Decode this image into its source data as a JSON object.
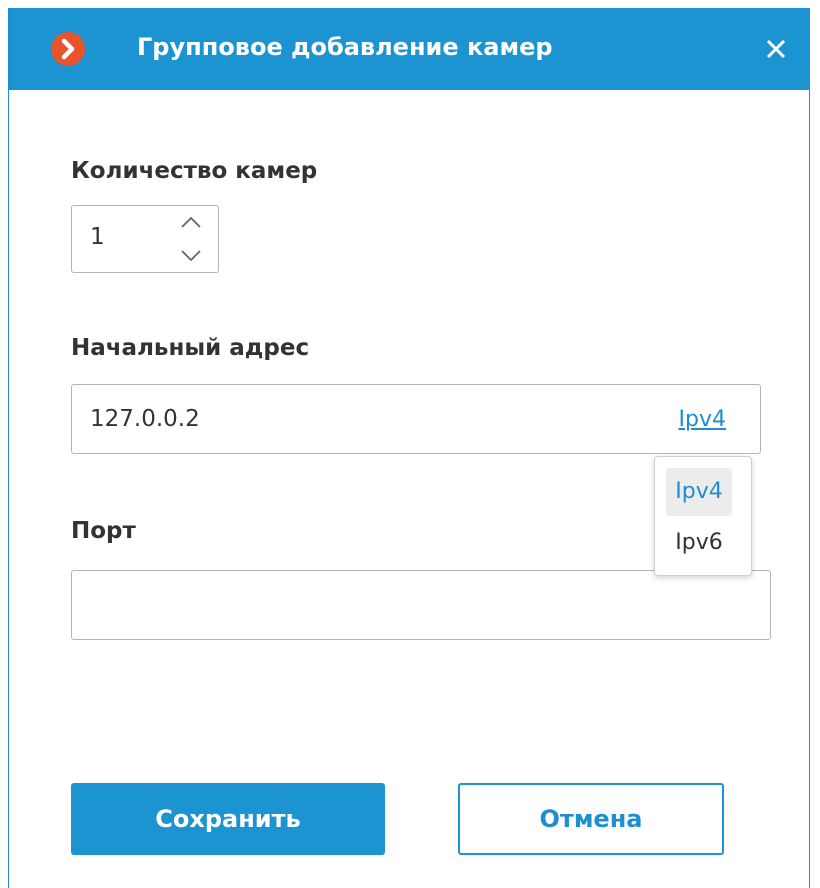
{
  "dialog": {
    "title": "Групповое добавление камер",
    "close_icon": "close-icon",
    "logo_icon": "app-logo-chevron-icon"
  },
  "camera_count": {
    "label": "Количество камер",
    "value": "1"
  },
  "start_address": {
    "label": "Начальный адрес",
    "value": "127.0.0.2",
    "ip_version": "Ipv4"
  },
  "ip_dropdown": {
    "options": [
      "Ipv4",
      "Ipv6"
    ],
    "selected": "Ipv4"
  },
  "port": {
    "label": "Порт",
    "value": ""
  },
  "buttons": {
    "save": "Сохранить",
    "cancel": "Отмена"
  },
  "colors": {
    "accent": "#1d94d2",
    "logo": "#e8542c",
    "link": "#1d8fd0"
  }
}
